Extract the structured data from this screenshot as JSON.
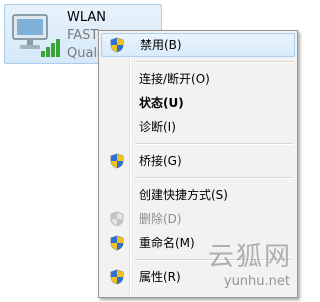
{
  "adapter": {
    "name": "WLAN",
    "line2": "FAST",
    "line3": "Qualc",
    "icon": "wireless-network-adapter-icon"
  },
  "menu": {
    "items": [
      {
        "label": "禁用(B)",
        "icon": "uac-shield-icon",
        "highlighted": true,
        "bold": false,
        "disabled": false
      },
      {
        "label": "连接/断开(O)",
        "icon": null,
        "highlighted": false,
        "bold": false,
        "disabled": false
      },
      {
        "label": "状态(U)",
        "icon": null,
        "highlighted": false,
        "bold": true,
        "disabled": false
      },
      {
        "label": "诊断(I)",
        "icon": null,
        "highlighted": false,
        "bold": false,
        "disabled": false
      },
      {
        "label": "桥接(G)",
        "icon": "uac-shield-icon",
        "highlighted": false,
        "bold": false,
        "disabled": false
      },
      {
        "label": "创建快捷方式(S)",
        "icon": null,
        "highlighted": false,
        "bold": false,
        "disabled": false
      },
      {
        "label": "删除(D)",
        "icon": "uac-shield-icon",
        "highlighted": false,
        "bold": false,
        "disabled": true
      },
      {
        "label": "重命名(M)",
        "icon": "uac-shield-icon",
        "highlighted": false,
        "bold": false,
        "disabled": false
      },
      {
        "label": "属性(R)",
        "icon": "uac-shield-icon",
        "highlighted": false,
        "bold": false,
        "disabled": false
      }
    ]
  },
  "watermark": {
    "cn": "云狐网",
    "url": "yunhu.net"
  },
  "colors": {
    "highlight_border": "#a8cff0",
    "menu_background": "#f2f2f2",
    "disabled_text": "#8d8d8d"
  }
}
